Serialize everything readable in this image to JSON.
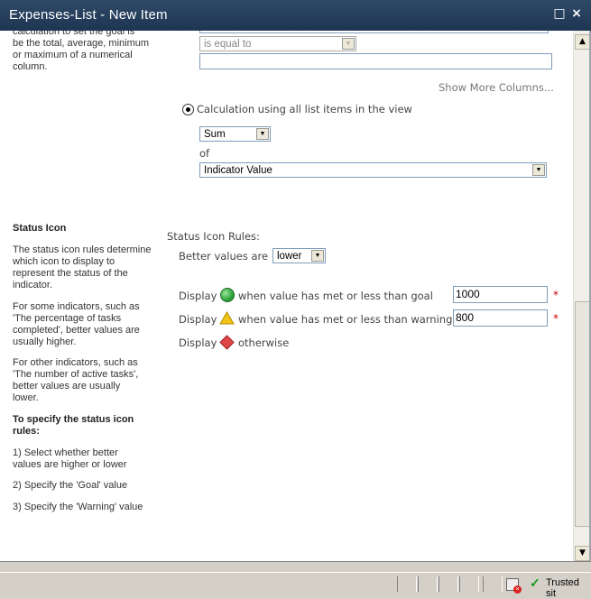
{
  "window": {
    "title": "Expenses-List - New Item",
    "maximize_glyph": "□",
    "close_glyph": "×"
  },
  "upper_section": {
    "left_description": [
      "calculation to set the goal is",
      "be the total, average, minimum",
      "or maximum of a numerical",
      "column."
    ],
    "condition_select": {
      "value": "is equal to",
      "disabled": true
    },
    "condition_value": "",
    "show_more_columns": "Show More Columns...",
    "calc_radio_label": "Calculation using all list items in the view",
    "calc_radio_selected": true,
    "aggregate_select": {
      "value": "Sum",
      "options_visible": [
        "Sum"
      ]
    },
    "of_label": "of",
    "column_select": {
      "value": "Indicator Value"
    }
  },
  "status_icon_section": {
    "heading": "Status Icon",
    "description_1": [
      "The status icon rules determine",
      "which icon to display to",
      "represent the status of the",
      "indicator."
    ],
    "description_2": [
      "For some indicators, such as",
      "'The percentage of tasks",
      "completed', better values are",
      "usually higher."
    ],
    "description_3": [
      "For other indicators, such as",
      "'The number of active tasks',",
      "better values are usually",
      "lower."
    ],
    "rules_heading": [
      "To specify the status icon",
      "rules:"
    ],
    "step_1": [
      "1) Select whether better",
      "values are higher or lower"
    ],
    "step_2": "2) Specify the 'Goal' value",
    "step_3": "3) Specify the 'Warning' value",
    "rules_label": "Status Icon Rules:",
    "better_values_label": "Better values are",
    "better_values_select": "lower",
    "goal_rule": {
      "prefix": "Display",
      "icon": "green-circle-icon",
      "text": "when value has met or less than goal",
      "value": "1000",
      "required_mark": "*"
    },
    "warning_rule": {
      "prefix": "Display",
      "icon": "yellow-triangle-icon",
      "text": "when value has met or less than warning",
      "value": "800",
      "required_mark": "*"
    },
    "otherwise_rule": {
      "prefix": "Display",
      "icon": "red-diamond-icon",
      "text": "otherwise"
    }
  },
  "statusbar": {
    "zone_text": "Trusted sit"
  },
  "colors": {
    "titlebar": "#1e3552",
    "goal": "#3ab54a",
    "warning": "#f2c418",
    "bad": "#e04646"
  }
}
